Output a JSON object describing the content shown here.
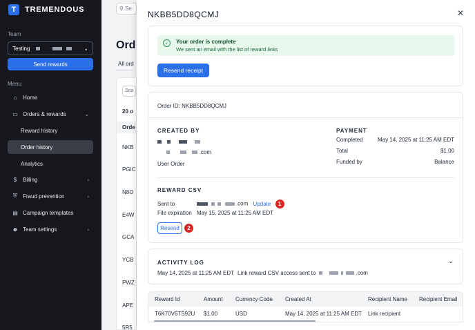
{
  "brand": {
    "name": "TREMENDOUS",
    "logo_letter": "T"
  },
  "sidebar": {
    "team_label": "Team",
    "team_value": "Testing",
    "send_rewards": "Send rewards",
    "menu_label": "Menu",
    "items": [
      {
        "label": "Home",
        "icon": "home-icon"
      },
      {
        "label": "Orders & rewards",
        "icon": "card-icon",
        "expanded": true
      },
      {
        "label": "Reward history",
        "sub": true
      },
      {
        "label": "Order history",
        "sub": true,
        "active": true
      },
      {
        "label": "Analytics",
        "sub": true
      },
      {
        "label": "Billing",
        "icon": "dollar-icon"
      },
      {
        "label": "Fraud prevention",
        "icon": "shield-icon"
      },
      {
        "label": "Campaign templates",
        "icon": "template-icon"
      },
      {
        "label": "Team settings",
        "icon": "users-icon"
      }
    ]
  },
  "background": {
    "search_placeholder": "Se",
    "title": "Ord",
    "tab": "All ord",
    "search2": "Sea",
    "count": "20 o",
    "column": "Orde",
    "rows": [
      "NKB",
      "PGIC",
      "N8O",
      "E4W",
      "GCA",
      "YCB",
      "PWZ",
      "APE",
      "5R5"
    ]
  },
  "drawer": {
    "title": "NKBB5DD8QCMJ",
    "alert_title": "Your order is complete",
    "alert_sub": "We sent an email with the list of reward links",
    "resend_receipt": "Resend receipt",
    "order_id": "Order ID: NKBB5DD8QCMJ",
    "created_by_label": "CREATED BY",
    "created_by_email_suffix": ".com",
    "created_by_type": "User Order",
    "payment_label": "PAYMENT",
    "payment": [
      {
        "key": "Completed",
        "value": "May 14, 2025 at 11:25 AM EDT"
      },
      {
        "key": "Total",
        "value": "$1.00"
      },
      {
        "key": "Funded by",
        "value": "Balance"
      }
    ],
    "reward_csv_label": "REWARD CSV",
    "sent_to_key": "Sent to",
    "sent_to_suffix": ".com",
    "update_link": "Update",
    "badge1": "1",
    "file_exp_key": "File expiration",
    "file_exp_value": "May 15, 2025 at 11:25 AM EDT",
    "resend": "Resend",
    "badge2": "2",
    "activity_label": "ACTIVITY LOG",
    "activity_time": "May 14, 2025 at 11:25 AM EDT",
    "activity_text": "Link reward CSV access sent to",
    "activity_suffix": ".com"
  },
  "table": {
    "columns": [
      "Reward Id",
      "Amount",
      "Currency Code",
      "Created At",
      "Recipient Name",
      "Recipient Email"
    ],
    "rows": [
      [
        "T6K70V6TS92U",
        "$1.00",
        "USD",
        "May 14, 2025 at 11:25 AM EDT",
        "Link recipient",
        ""
      ]
    ]
  },
  "colors": {
    "accent": "#2b6fe8",
    "sidebar": "#15171c",
    "success_bg": "#e9f8ec",
    "badge": "#dc2626"
  }
}
